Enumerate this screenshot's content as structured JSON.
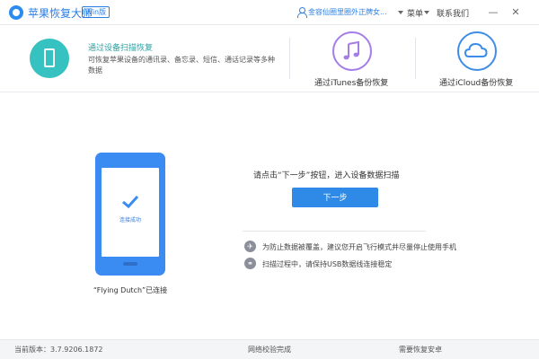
{
  "titlebar": {
    "app_title": "苹果恢复大师",
    "version_badge": "Win版",
    "user_name": "金容仙圈里圈外正牌女...",
    "menu": [
      "菜单",
      "联系我们"
    ]
  },
  "modes": [
    {
      "title": "通过设备扫描恢复",
      "desc": "可恢复苹果设备的通讯录、备忘录、短信、通话记录等多种数据",
      "icon": "phone-icon",
      "color": "#36c2c0"
    },
    {
      "label": "通过iTunes备份恢复",
      "icon": "music-note-icon",
      "color": "#a57de6"
    },
    {
      "label": "通过iCloud备份恢复",
      "icon": "cloud-icon",
      "color": "#3d8de8"
    }
  ],
  "main": {
    "phone_status": "连接成功",
    "device_name": "“Flying Dutch”已连接",
    "prompt": "请点击“下一步”按钮，进入设备数据扫描",
    "next_button": "下一步",
    "tips": [
      {
        "icon": "airplane-icon",
        "text": "为防止数据被覆盖，建议您开启飞行模式并尽量停止使用手机"
      },
      {
        "icon": "usb-icon",
        "text": "扫描过程中，请保持USB数据线连接稳定"
      }
    ]
  },
  "status": {
    "version": "当前版本：3.7.9206.1872",
    "network": "网络校验完成",
    "right": "需要恢复安卓"
  }
}
